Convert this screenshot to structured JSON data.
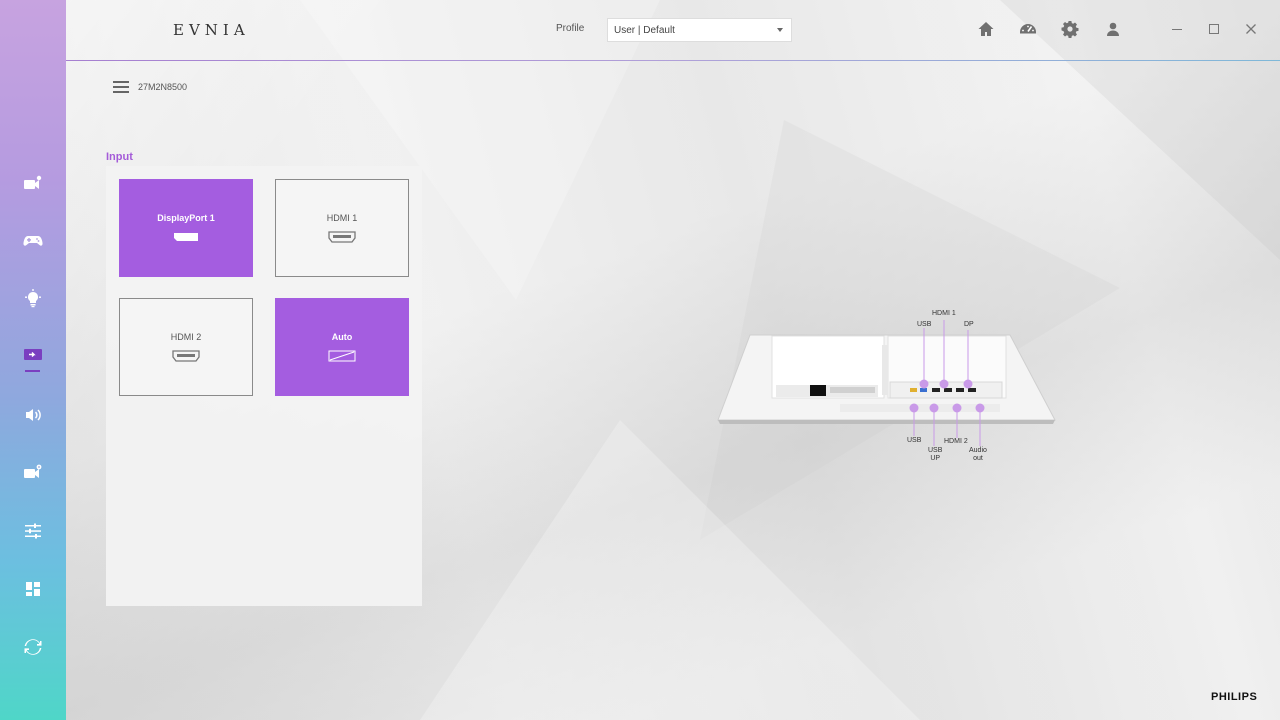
{
  "app": {
    "brand": "EVNIA",
    "vendor": "PHILIPS"
  },
  "header": {
    "profile_label": "Profile",
    "profile_value": "User | Default"
  },
  "device": {
    "model": "27M2N8500"
  },
  "sidebar": {
    "items": [
      {
        "icon": "picture-settings-icon"
      },
      {
        "icon": "gamepad-icon"
      },
      {
        "icon": "lightbulb-icon"
      },
      {
        "icon": "input-source-icon",
        "active": true
      },
      {
        "icon": "speaker-icon"
      },
      {
        "icon": "system-settings-icon"
      },
      {
        "icon": "sliders-icon"
      },
      {
        "icon": "widgets-icon"
      },
      {
        "icon": "refresh-icon"
      }
    ]
  },
  "input": {
    "title": "Input",
    "options": [
      {
        "label": "DisplayPort 1",
        "icon": "displayport-icon",
        "selected": true
      },
      {
        "label": "HDMI 1",
        "icon": "hdmi-icon",
        "selected": false
      },
      {
        "label": "HDMI 2",
        "icon": "hdmi-icon",
        "selected": false
      },
      {
        "label": "Auto",
        "icon": "auto-icon",
        "selected": true
      }
    ]
  },
  "ports": {
    "hdmi1": "HDMI 1",
    "usb_top": "USB",
    "dp": "DP",
    "usb_bottom": "USB",
    "usb_up_line1": "USB",
    "usb_up_line2": "UP",
    "hdmi2": "HDMI 2",
    "audio_line1": "Audio",
    "audio_line2": "out"
  },
  "colors": {
    "accent": "#a45de0",
    "active_indicator": "#7a3fc0"
  }
}
